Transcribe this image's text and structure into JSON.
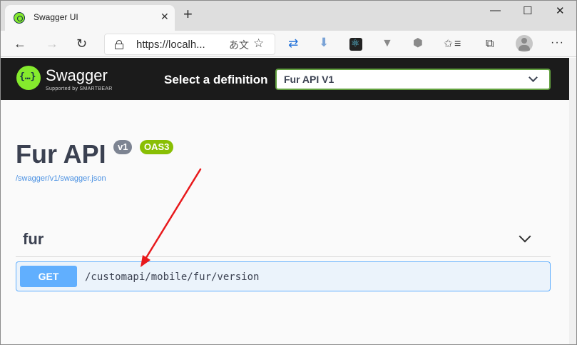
{
  "browser": {
    "tab_title": "Swagger UI",
    "tab_close": "✕",
    "new_tab": "+",
    "window_controls": {
      "minimize": "—",
      "maximize": "☐",
      "close": "✕"
    },
    "url": "https://localh...",
    "icons": {
      "back": "←",
      "forward": "→",
      "reload": "↻",
      "translate": "あ文",
      "favorite": "☆",
      "ext1": "⇄",
      "ext2": "⬇",
      "ext4": "▼",
      "ext5": "⬢",
      "ext6": "✩",
      "ext7": "≡",
      "collections": "⧉",
      "menu": "···"
    }
  },
  "swagger": {
    "brand": "Swagger",
    "brand_sub": "Supported by SMARTBEAR",
    "logo_glyph": "{…}",
    "select_label": "Select a definition",
    "selected_definition": "Fur API V1"
  },
  "api": {
    "title": "Fur API",
    "version_badge": "v1",
    "oas_badge": "OAS3",
    "spec_link": "/swagger/v1/swagger.json"
  },
  "tags": [
    {
      "name": "fur",
      "operations": [
        {
          "method": "GET",
          "path": "/customapi/mobile/fur/version"
        }
      ]
    }
  ],
  "colors": {
    "swagger_green": "#85ea2d",
    "get_blue": "#61affe",
    "annotation_arrow": "#e8191c"
  }
}
